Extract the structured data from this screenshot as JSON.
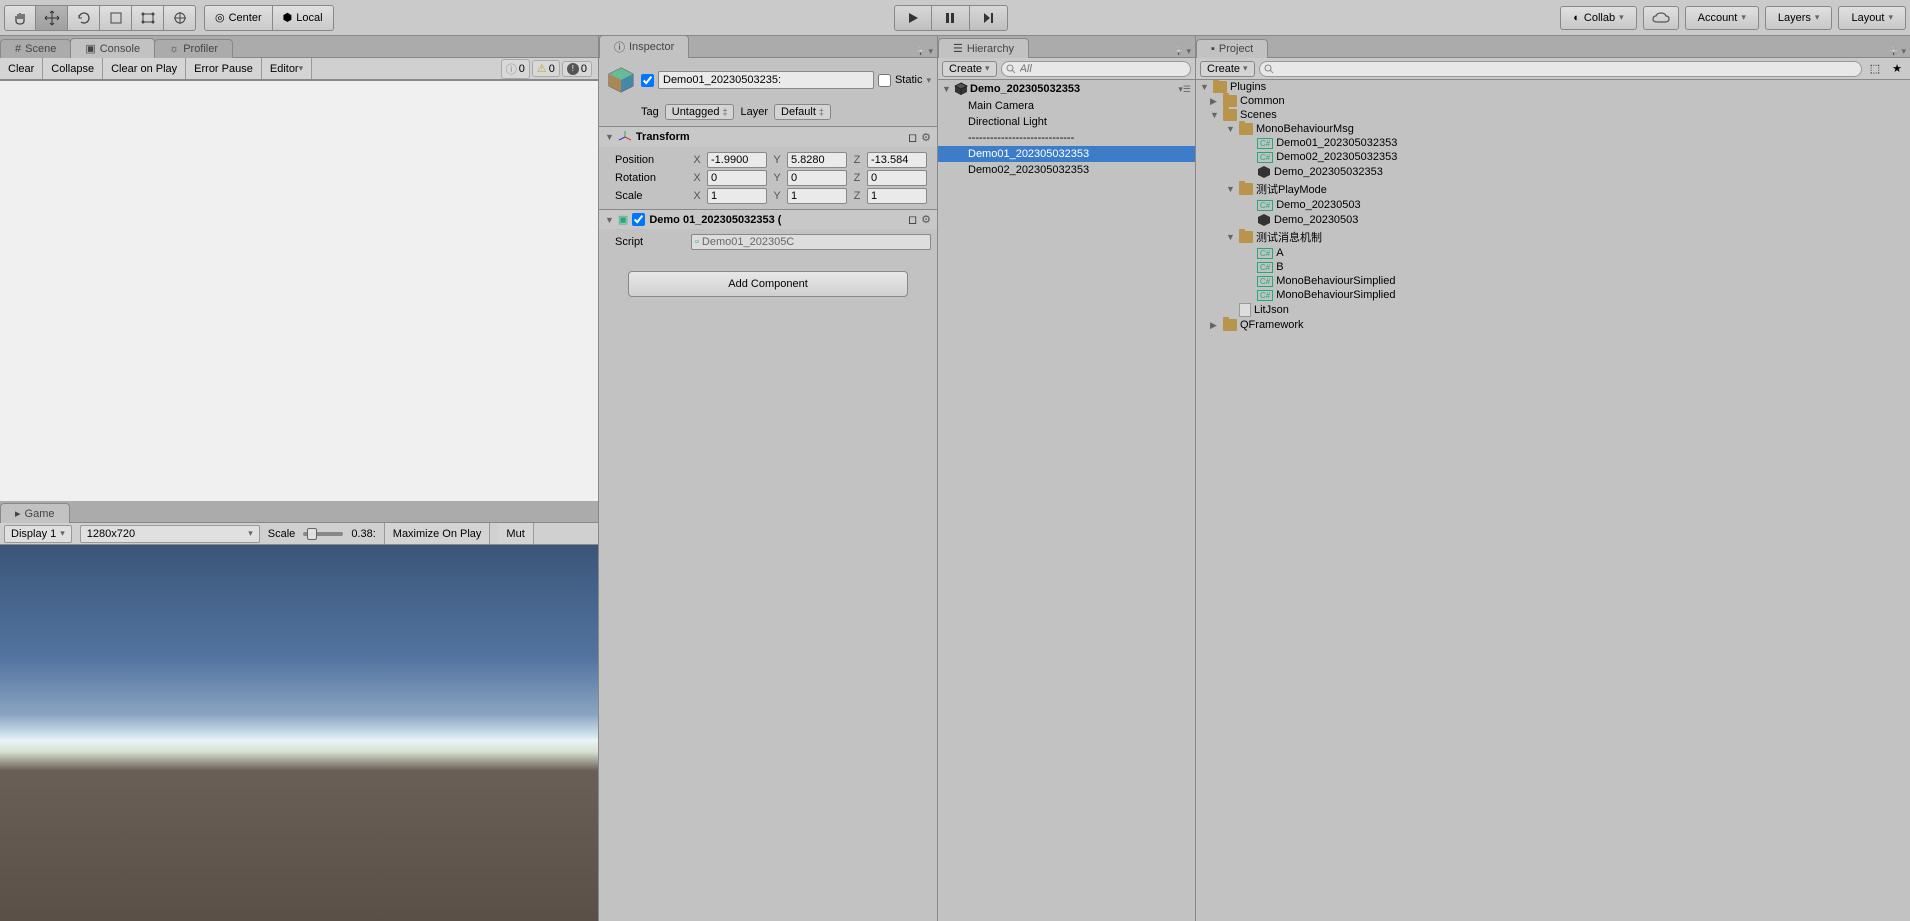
{
  "toolbar": {
    "center_label": "Center",
    "local_label": "Local",
    "collab_label": "Collab",
    "account_label": "Account",
    "layers_label": "Layers",
    "layout_label": "Layout"
  },
  "tabs": {
    "scene": "Scene",
    "console": "Console",
    "profiler": "Profiler",
    "game": "Game",
    "inspector": "Inspector",
    "hierarchy": "Hierarchy",
    "project": "Project"
  },
  "console": {
    "clear": "Clear",
    "collapse": "Collapse",
    "clear_on_play": "Clear on Play",
    "error_pause": "Error Pause",
    "editor": "Editor",
    "info_count": "0",
    "warn_count": "0",
    "error_count": "0"
  },
  "game": {
    "display": "Display 1",
    "resolution": "1280x720",
    "scale_label": "Scale",
    "scale_value": "0.38:",
    "maximize": "Maximize On Play",
    "mute": "Mut"
  },
  "inspector": {
    "obj_name": "Demo01_20230503235:",
    "static": "Static",
    "tag_label": "Tag",
    "tag_value": "Untagged",
    "layer_label": "Layer",
    "layer_value": "Default",
    "transform": {
      "title": "Transform",
      "position": "Position",
      "rotation": "Rotation",
      "scale": "Scale",
      "px": "-1.9900",
      "py": "5.8280",
      "pz": "-13.584",
      "rx": "0",
      "ry": "0",
      "rz": "0",
      "sx": "1",
      "sy": "1",
      "sz": "1"
    },
    "component1": {
      "title": "Demo 01_202305032353 (",
      "script_label": "Script",
      "script_value": "Demo01_202305C"
    },
    "add_component": "Add Component"
  },
  "hierarchy": {
    "create": "Create",
    "search_placeholder": "All",
    "scene_name": "Demo_202305032353",
    "items": [
      "Main Camera",
      "Directional Light",
      "-----------------------------",
      "Demo01_202305032353",
      "Demo02_202305032353"
    ]
  },
  "project": {
    "create": "Create",
    "items": {
      "plugins": "Plugins",
      "common": "Common",
      "scenes": "Scenes",
      "mono_msg": "MonoBehaviourMsg",
      "demo01": "Demo01_202305032353",
      "demo02": "Demo02_202305032353",
      "demo_scene": "Demo_202305032353",
      "test_play": "测试PlayMode",
      "demo_0503a": "Demo_20230503",
      "demo_0503b": "Demo_20230503",
      "test_msg": "测试消息机制",
      "a": "A",
      "b": "B",
      "mono_simp1": "MonoBehaviourSimplied",
      "mono_simp2": "MonoBehaviourSimplied",
      "litjson": "LitJson",
      "qframework": "QFramework"
    }
  }
}
